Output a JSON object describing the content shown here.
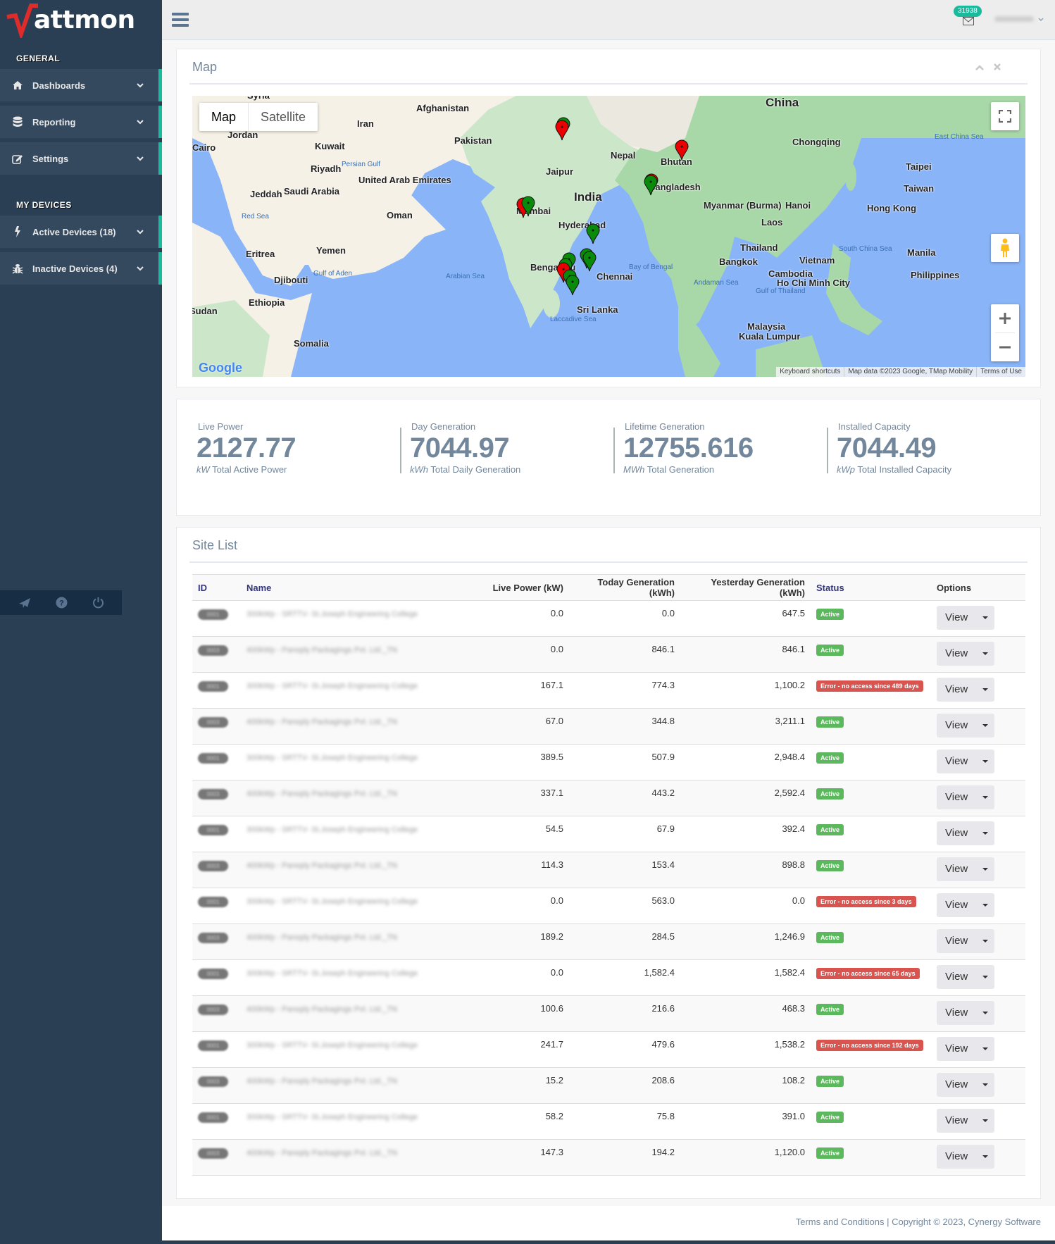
{
  "brand": {
    "name": "attmon",
    "logo_letter": "W",
    "accent_color": "#1abb9c",
    "logo_color": "#e02b2b"
  },
  "sidebar": {
    "general_title": "GENERAL",
    "general_items": [
      {
        "label": "Dashboards",
        "icon": "home-icon"
      },
      {
        "label": "Reporting",
        "icon": "database-icon"
      },
      {
        "label": "Settings",
        "icon": "edit-icon"
      }
    ],
    "devices_title": "MY DEVICES",
    "device_items": [
      {
        "label": "Active Devices (18)",
        "icon": "bolt-icon"
      },
      {
        "label": "Inactive Devices (4)",
        "icon": "bug-icon"
      }
    ],
    "footer_icons": [
      "paper-plane-icon",
      "question-circle-icon",
      "power-icon"
    ]
  },
  "topbar": {
    "mail_count": "31938",
    "user_name": "adminenergy"
  },
  "map_panel": {
    "title": "Map",
    "map_type_options": [
      "Map",
      "Satellite"
    ],
    "map_type_selected": "Map",
    "attribution": [
      "Keyboard shortcuts",
      "Map data ©2023 Google, TMap Mobility",
      "Terms of Use"
    ],
    "google_logo": "Google",
    "labels": {
      "countries": [
        "Syria",
        "Jordan",
        "Afghanistan",
        "Iran",
        "Pakistan",
        "Kuwait",
        "Saudi Arabia",
        "United Arab Emirates",
        "Oman",
        "Yemen",
        "Eritrea",
        "Djibouti",
        "Ethiopia",
        "Sudan",
        "Somalia",
        "India",
        "Nepal",
        "Bhutan",
        "Bangladesh",
        "China",
        "Myanmar (Burma)",
        "Laos",
        "Thailand",
        "Vietnam",
        "Cambodia",
        "Malaysia",
        "Philippines",
        "Taiwan",
        "Sri Lanka"
      ],
      "cities": [
        "Cairo",
        "Riyadh",
        "Jeddah",
        "Jaipur",
        "Mumbai",
        "Hyderabad",
        "Bengaluru",
        "Chennai",
        "Chongqing",
        "Hanoi",
        "Hong Kong",
        "Taipei",
        "Bangkok",
        "Ho Chi Minh City",
        "Manila",
        "Kuala Lumpur"
      ],
      "seas": [
        "Persian Gulf",
        "Red Sea",
        "Gulf of Aden",
        "Arabian Sea",
        "Laccadive Sea",
        "Bay of Bengal",
        "Andaman Sea",
        "Gulf of Thailand",
        "South China Sea",
        "East China Sea"
      ]
    },
    "markers": [
      {
        "site": "Punjab/Haryana",
        "status": "active"
      },
      {
        "site": "Punjab/Haryana",
        "status": "error"
      },
      {
        "site": "Mumbai",
        "status": "error"
      },
      {
        "site": "Mumbai",
        "status": "active"
      },
      {
        "site": "Hyderabad",
        "status": "active"
      },
      {
        "site": "Bengaluru",
        "status": "active"
      },
      {
        "site": "Bengaluru",
        "status": "active"
      },
      {
        "site": "Bengaluru",
        "status": "error"
      },
      {
        "site": "Tamil Nadu",
        "status": "active"
      },
      {
        "site": "Tamil Nadu",
        "status": "active"
      },
      {
        "site": "Chennai",
        "status": "active"
      },
      {
        "site": "Chennai",
        "status": "active"
      },
      {
        "site": "West Bengal",
        "status": "error"
      },
      {
        "site": "West Bengal",
        "status": "active"
      },
      {
        "site": "Bhutan",
        "status": "error"
      }
    ]
  },
  "stats": [
    {
      "label": "Live Power",
      "value": "2127.77",
      "unit": "kW",
      "description": "Total Active Power"
    },
    {
      "label": "Day Generation",
      "value": "7044.97",
      "unit": "kWh",
      "description": "Total Daily Generation"
    },
    {
      "label": "Lifetime Generation",
      "value": "12755.616",
      "unit": "MWh",
      "description": "Total Generation"
    },
    {
      "label": "Installed Capacity",
      "value": "7044.49",
      "unit": "kWp",
      "description": "Total Installed Capacity"
    }
  ],
  "site_list": {
    "title": "Site List",
    "columns": [
      "ID",
      "Name",
      "Live Power (kW)",
      "Today Generation (kWh)",
      "Yesterday Generation (kWh)",
      "Status",
      "Options"
    ],
    "view_label": "View",
    "rows": [
      {
        "id": "0001",
        "name": "300kWp - SRTTV- St.Joseph Engineering College",
        "live": "0.0",
        "today": "0.0",
        "yesterday": "647.5",
        "status": "Active",
        "status_type": "active"
      },
      {
        "id": "0003",
        "name": "400kWp - Panoply Packagings Pvt. Ltd._TN",
        "live": "0.0",
        "today": "846.1",
        "yesterday": "846.1",
        "status": "Active",
        "status_type": "active"
      },
      {
        "id": "0001",
        "name": "300kWp - SRTTV- St.Joseph Engineering College",
        "live": "167.1",
        "today": "774.3",
        "yesterday": "1,100.2",
        "status": "Error - no access since 489 days",
        "status_type": "error"
      },
      {
        "id": "0003",
        "name": "400kWp - Panoply Packagings Pvt. Ltd._TN",
        "live": "67.0",
        "today": "344.8",
        "yesterday": "3,211.1",
        "status": "Active",
        "status_type": "active"
      },
      {
        "id": "0001",
        "name": "300kWp - SRTTV- St.Joseph Engineering College",
        "live": "389.5",
        "today": "507.9",
        "yesterday": "2,948.4",
        "status": "Active",
        "status_type": "active"
      },
      {
        "id": "0003",
        "name": "400kWp - Panoply Packagings Pvt. Ltd._TN",
        "live": "337.1",
        "today": "443.2",
        "yesterday": "2,592.4",
        "status": "Active",
        "status_type": "active"
      },
      {
        "id": "0001",
        "name": "300kWp - SRTTV- St.Joseph Engineering College",
        "live": "54.5",
        "today": "67.9",
        "yesterday": "392.4",
        "status": "Active",
        "status_type": "active"
      },
      {
        "id": "0003",
        "name": "400kWp - Panoply Packagings Pvt. Ltd._TN",
        "live": "114.3",
        "today": "153.4",
        "yesterday": "898.8",
        "status": "Active",
        "status_type": "active"
      },
      {
        "id": "0001",
        "name": "300kWp - SRTTV- St.Joseph Engineering College",
        "live": "0.0",
        "today": "563.0",
        "yesterday": "0.0",
        "status": "Error - no access since 3 days",
        "status_type": "error"
      },
      {
        "id": "0003",
        "name": "400kWp - Panoply Packagings Pvt. Ltd._TN",
        "live": "189.2",
        "today": "284.5",
        "yesterday": "1,246.9",
        "status": "Active",
        "status_type": "active"
      },
      {
        "id": "0001",
        "name": "300kWp - SRTTV- St.Joseph Engineering College",
        "live": "0.0",
        "today": "1,582.4",
        "yesterday": "1,582.4",
        "status": "Error - no access since 65 days",
        "status_type": "error"
      },
      {
        "id": "0003",
        "name": "400kWp - Panoply Packagings Pvt. Ltd._TN",
        "live": "100.6",
        "today": "216.6",
        "yesterday": "468.3",
        "status": "Active",
        "status_type": "active"
      },
      {
        "id": "0001",
        "name": "300kWp - SRTTV- St.Joseph Engineering College",
        "live": "241.7",
        "today": "479.6",
        "yesterday": "1,538.2",
        "status": "Error - no access since 192 days",
        "status_type": "error"
      },
      {
        "id": "0003",
        "name": "400kWp - Panoply Packagings Pvt. Ltd._TN",
        "live": "15.2",
        "today": "208.6",
        "yesterday": "108.2",
        "status": "Active",
        "status_type": "active"
      },
      {
        "id": "0001",
        "name": "300kWp - SRTTV- St.Joseph Engineering College",
        "live": "58.2",
        "today": "75.8",
        "yesterday": "391.0",
        "status": "Active",
        "status_type": "active"
      },
      {
        "id": "0003",
        "name": "400kWp - Panoply Packagings Pvt. Ltd._TN",
        "live": "147.3",
        "today": "194.2",
        "yesterday": "1,120.0",
        "status": "Active",
        "status_type": "active"
      }
    ]
  },
  "footer": {
    "terms_link": "Terms and Conditions",
    "copyright": " | Copyright © 2023, Cynergy Software"
  }
}
